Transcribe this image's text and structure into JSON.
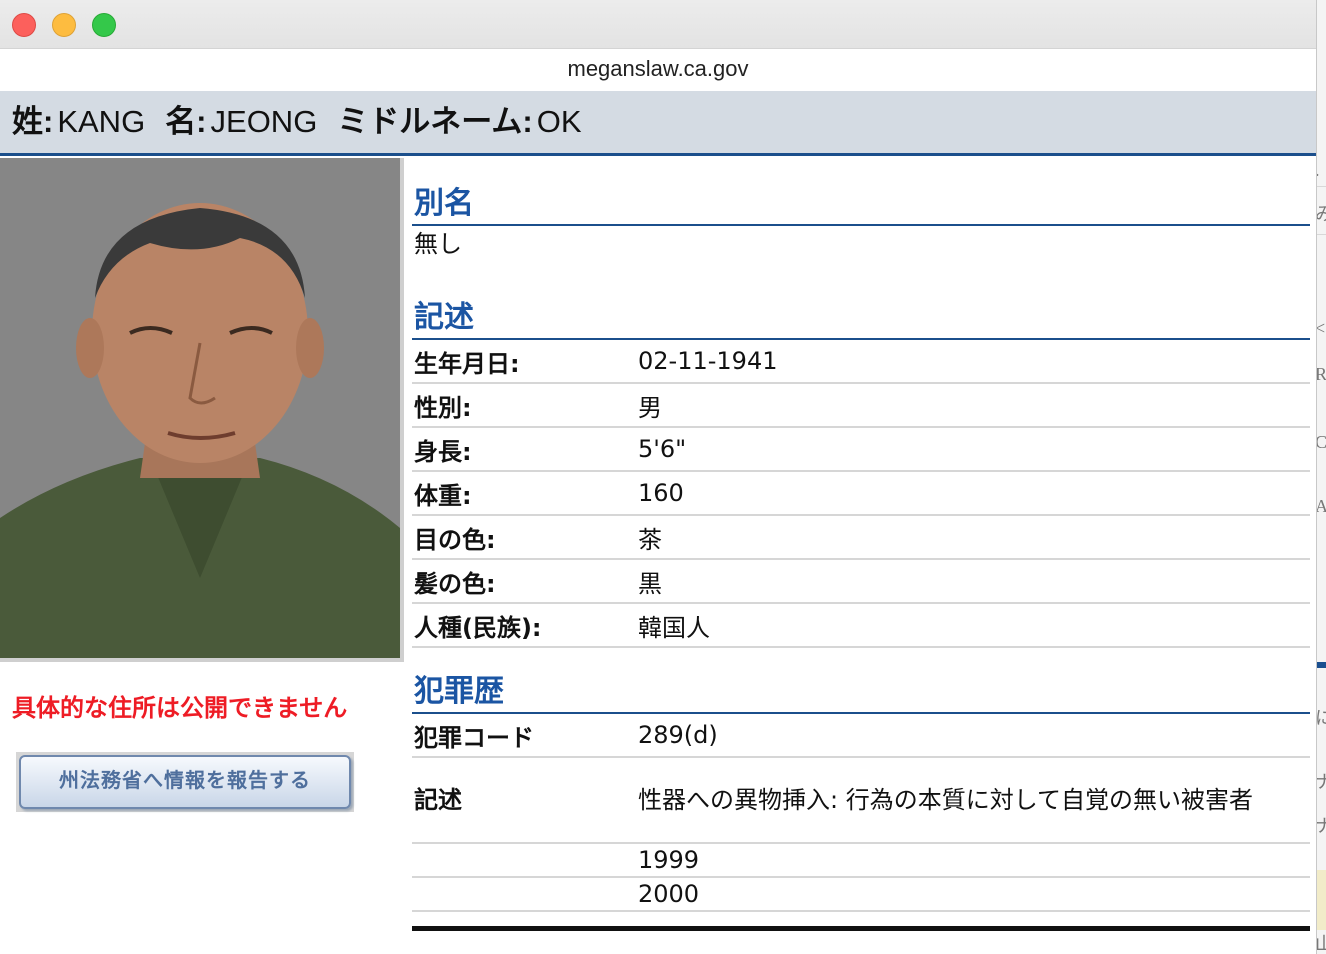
{
  "window": {
    "url": "meganslaw.ca.gov"
  },
  "name_bar": {
    "last_label": "姓:",
    "last_value": "KANG",
    "first_label": "名:",
    "first_value": "JEONG",
    "middle_label": "ミドルネーム:",
    "middle_value": "OK"
  },
  "left": {
    "address_note": "具体的な住所は公開できません",
    "report_button": "州法務省へ情報を報告する"
  },
  "aliases": {
    "title": "別名",
    "value": "無し"
  },
  "description": {
    "title": "記述",
    "rows": [
      {
        "label": "生年月日:",
        "value": "02-11-1941"
      },
      {
        "label": "性別:",
        "value": "男"
      },
      {
        "label": "身長:",
        "value": "5'6\""
      },
      {
        "label": "体重:",
        "value": "160"
      },
      {
        "label": "目の色:",
        "value": "茶"
      },
      {
        "label": "髪の色:",
        "value": "黒"
      },
      {
        "label": "人種(民族):",
        "value": "韓国人"
      }
    ]
  },
  "offenses": {
    "title": "犯罪歴",
    "code_label": "犯罪コード",
    "code_value": "289(d)",
    "desc_label": "記述",
    "desc_value": "性器への異物挿入: 行為の本質に対して自覚の無い被害者",
    "years": [
      "1999",
      "2000"
    ]
  },
  "background_window": {
    "glyphs": [
      ".",
      "み",
      "<",
      "R",
      "C",
      "A",
      "に",
      "ナ",
      "山"
    ]
  },
  "colors": {
    "section_title": "#1b55a3",
    "rule": "#1b4f8c",
    "name_bar_bg": "#d4dbe3",
    "alert_red": "#ee1c25"
  }
}
